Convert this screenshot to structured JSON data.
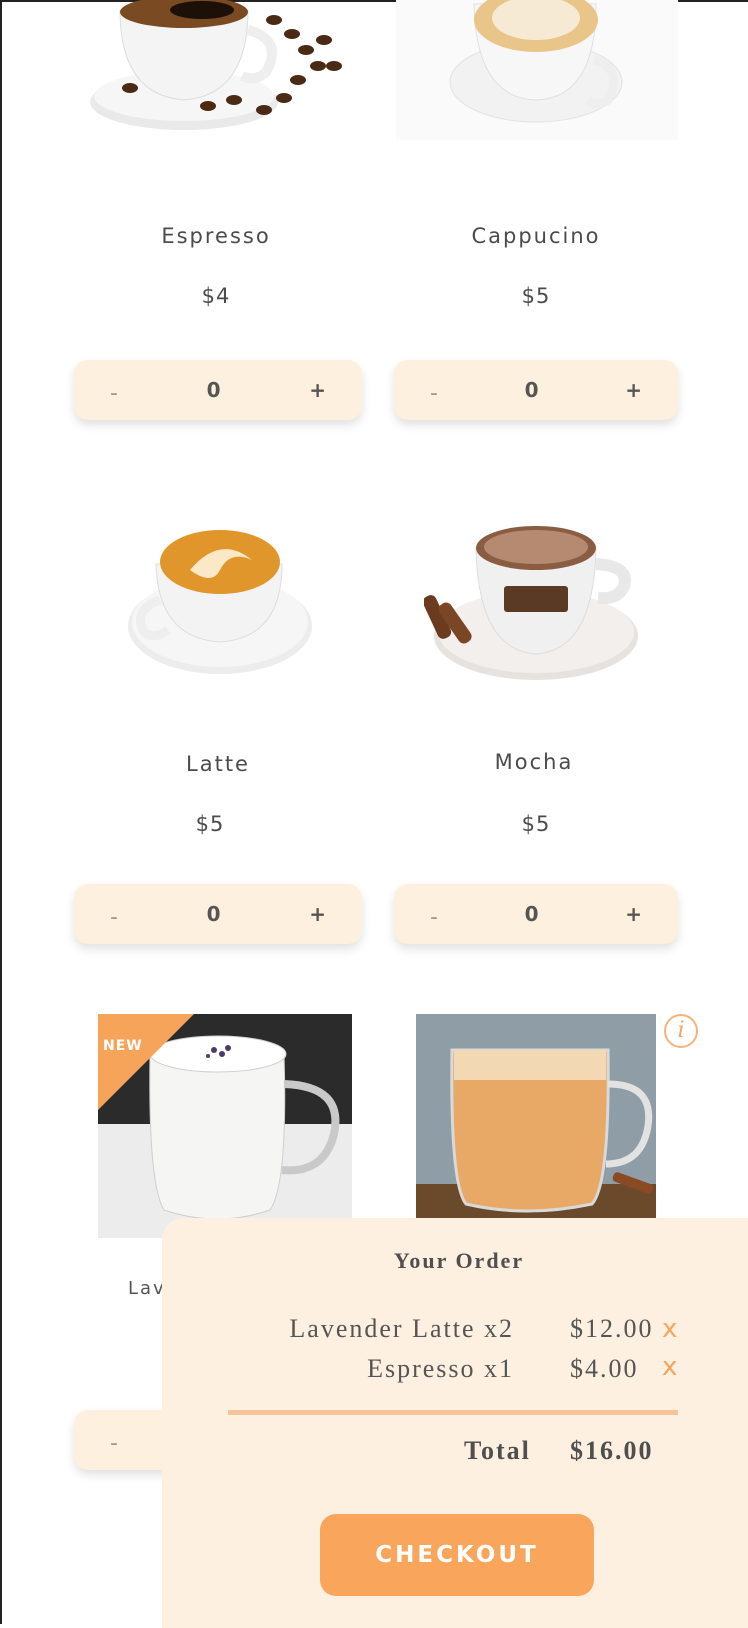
{
  "products": [
    {
      "name": "Espresso",
      "price": "$4",
      "qty": "0",
      "minus": "-",
      "plus": "+",
      "image": "espresso-cup-image"
    },
    {
      "name": "Cappucino",
      "price": "$5",
      "qty": "0",
      "minus": "-",
      "plus": "+",
      "image": "cappuccino-cup-image"
    },
    {
      "name": "Latte",
      "price": "$5",
      "qty": "0",
      "minus": "-",
      "plus": "+",
      "image": "latte-art-cup-image"
    },
    {
      "name": "Mocha",
      "price": "$5",
      "qty": "0",
      "minus": "-",
      "plus": "+",
      "image": "mocha-cup-image"
    },
    {
      "name": "Lav",
      "price": "",
      "qty": "",
      "minus": "-",
      "plus": "",
      "image": "lavender-latte-glass-image",
      "badge": "NEW"
    },
    {
      "name": "",
      "price": "",
      "qty": "",
      "minus": "",
      "plus": "",
      "image": "chai-latte-glass-image"
    }
  ],
  "info_icon": "i",
  "order": {
    "title": "Your Order",
    "items": [
      {
        "label": "Lavender Latte x2",
        "price": "$12.00",
        "remove": "x"
      },
      {
        "label": "Espresso x1",
        "price": "$4.00",
        "remove": "x"
      }
    ],
    "total_label": "Total",
    "total_value": "$16.00",
    "checkout_label": "CHECKOUT"
  },
  "colors": {
    "accent": "#f9a55c",
    "panel": "#fdf0e1",
    "stepper": "#fdf0df"
  }
}
